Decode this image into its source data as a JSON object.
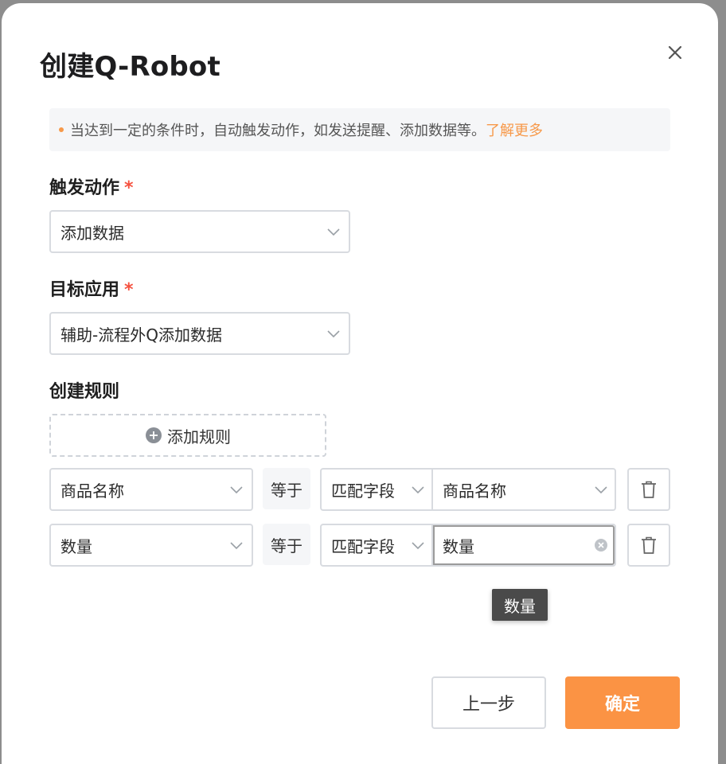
{
  "dialog": {
    "title": "创建Q-Robot",
    "notice": {
      "text": "当达到一定的条件时，自动触发动作，如发送提醒、添加数据等。",
      "link": "了解更多"
    },
    "trigger": {
      "label": "触发动作",
      "required_mark": "*",
      "value": "添加数据"
    },
    "target_app": {
      "label": "目标应用",
      "required_mark": "*",
      "value": "辅助-流程外Q添加数据"
    },
    "rules": {
      "label": "创建规则",
      "add_button": "添加规则",
      "items": [
        {
          "field": "商品名称",
          "operator": "等于",
          "match_type": "匹配字段",
          "match_value": "商品名称"
        },
        {
          "field": "数量",
          "operator": "等于",
          "match_type": "匹配字段",
          "match_value": "数量"
        }
      ]
    },
    "tooltip": "数量",
    "buttons": {
      "prev": "上一步",
      "confirm": "确定"
    }
  },
  "colors": {
    "accent": "#fb9344",
    "required": "#f5513f",
    "link": "#f7994a"
  }
}
